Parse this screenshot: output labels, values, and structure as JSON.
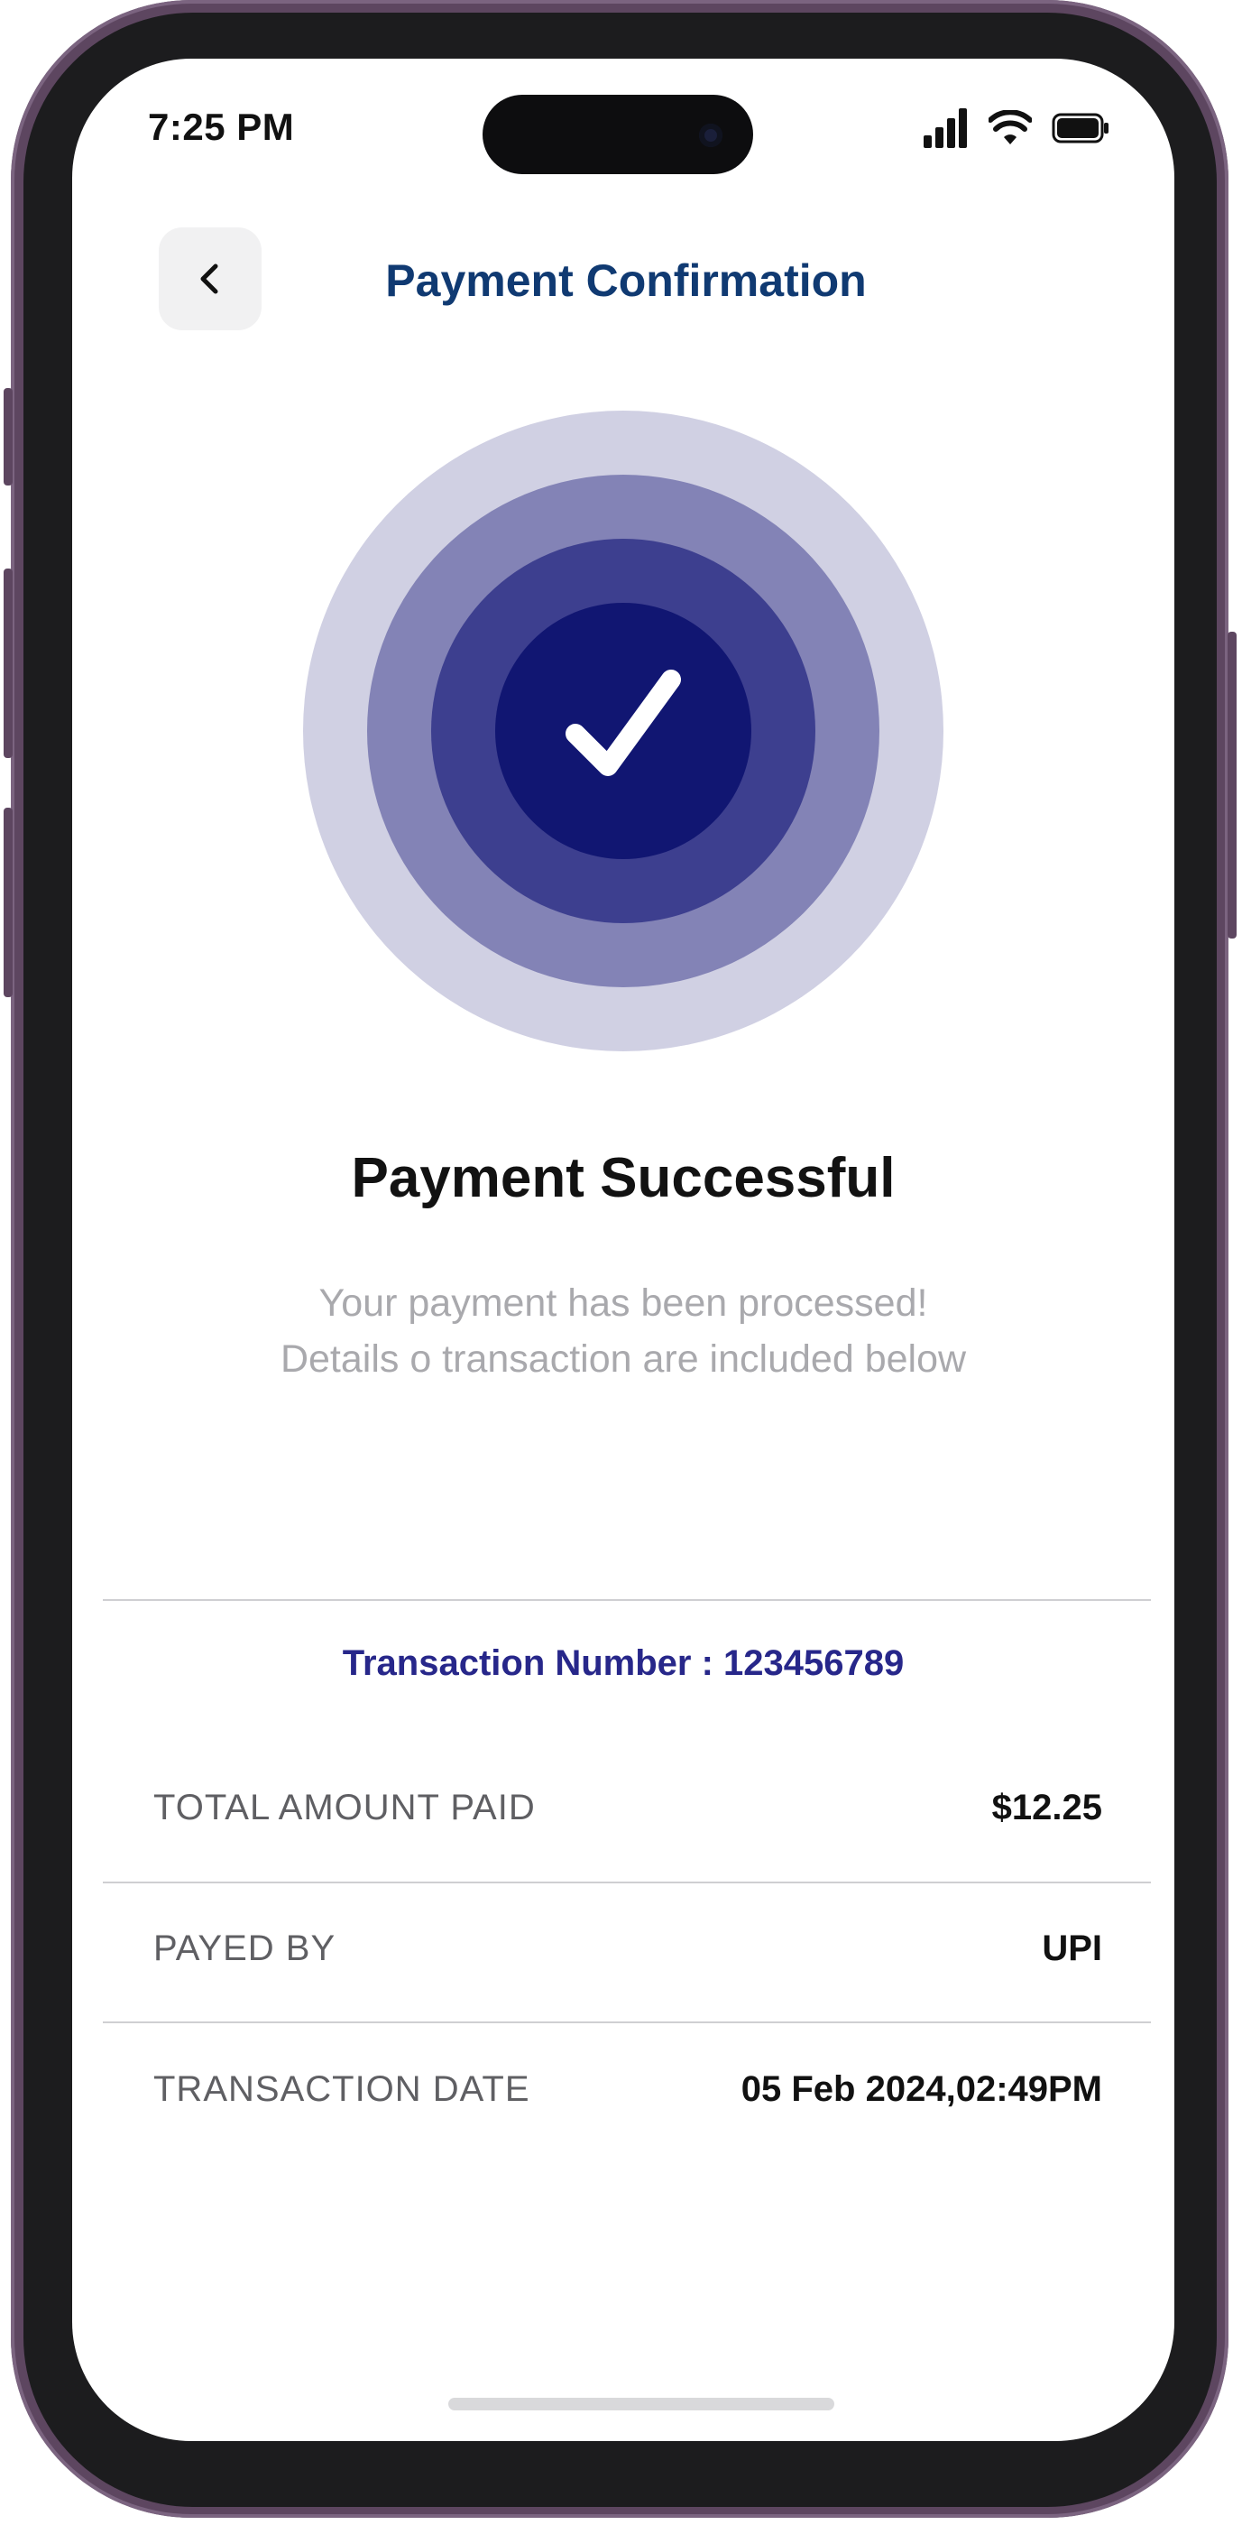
{
  "status_bar": {
    "time": "7:25 PM",
    "icons": [
      "cellular-signal-icon",
      "wifi-icon",
      "battery-icon"
    ]
  },
  "header": {
    "back_icon": "chevron-left-icon",
    "title": "Payment Confirmation"
  },
  "hero": {
    "icon": "checkmark-icon",
    "ring_colors": [
      "#d0d0e3",
      "#8383b6",
      "#3d3f8f",
      "#111672"
    ]
  },
  "result": {
    "title": "Payment Successful",
    "subtitle_line1": "Your payment has been processed!",
    "subtitle_line2": "Details o transaction are included below"
  },
  "transaction": {
    "number_label": "Transaction Number : 123456789"
  },
  "details": [
    {
      "label": "TOTAL AMOUNT PAID",
      "value": "$12.25"
    },
    {
      "label": "PAYED BY",
      "value": "UPI"
    },
    {
      "label": "TRANSACTION DATE",
      "value": "05 Feb 2024,02:49PM"
    }
  ],
  "colors": {
    "title_blue": "#103a72",
    "accent_navy": "#27278a",
    "frame": "#5d4660"
  }
}
